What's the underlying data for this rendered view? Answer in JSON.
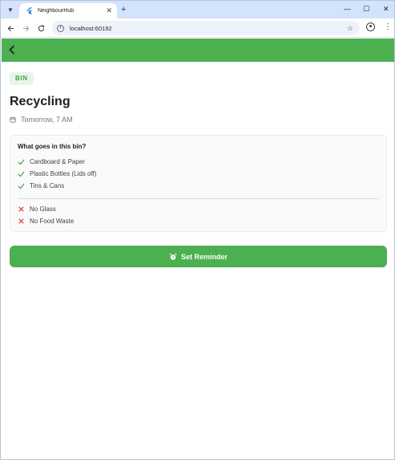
{
  "browser": {
    "tab_title": "NeighbourHub",
    "tab_close": "✕",
    "new_tab": "+",
    "url": "localhost:60192",
    "win_minimize": "—",
    "win_maximize": "☐",
    "win_close": "✕"
  },
  "page": {
    "chip": "BIN",
    "title": "Recycling",
    "datetime": "Tomorrow, 7 AM",
    "card": {
      "heading": "What goes in this bin?",
      "allowed": [
        "Cardboard & Paper",
        "Plastic Bottles (Lids off)",
        "Tins & Cans"
      ],
      "not_allowed": [
        "No Glass",
        "No Food Waste"
      ]
    },
    "button_label": "Set Reminder"
  },
  "colors": {
    "brand_green": "#4caf50",
    "check_green": "#43a047",
    "cross_red": "#e53935"
  }
}
